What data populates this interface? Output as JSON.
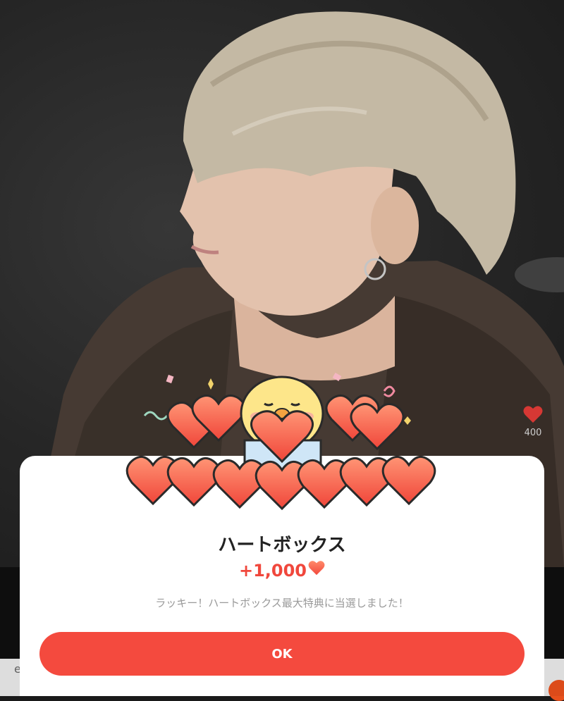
{
  "stream": {
    "like_count": "400",
    "bottom_text": "e"
  },
  "modal": {
    "title": "ハートボックス",
    "amount": "+1,000",
    "message": "ラッキー！ハートボックス最大特典に当選しました！",
    "ok_label": "OK"
  },
  "colors": {
    "accent": "#f44a3e",
    "amount": "#f0473c",
    "like_heart": "#e23b37"
  },
  "icons": {
    "like": "heart-icon",
    "amount": "heart-icon",
    "illustration": "chick-with-hearts-illustration"
  }
}
